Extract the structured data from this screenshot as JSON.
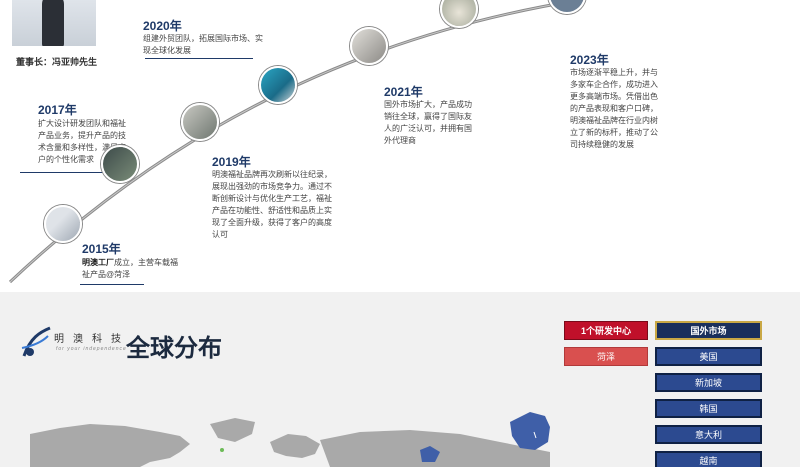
{
  "timeline": {
    "chairman_caption": "董事长：冯亚帅先生",
    "events": [
      {
        "year": "2020年",
        "desc": [
          "组建外贸团队，拓展国际市场、实",
          "现全球化发展"
        ]
      },
      {
        "year": "2017年",
        "desc": [
          "扩大设计研发团队和福祉",
          "产品业务，提升产品的技",
          "术含量和多样性，满足客",
          "户的个性化需求"
        ]
      },
      {
        "year": "2021年",
        "desc": [
          "国外市场扩大，产品成功",
          "销往全球，赢得了国际友",
          "人的广泛认可，并拥有国",
          "外代理商"
        ]
      },
      {
        "year": "2023年",
        "desc": [
          "市场逐渐平稳上升，并与",
          "多家车企合作，成功进入",
          "更多高端市场。凭借出色",
          "的产品表现和客户口碑，",
          "明澳福祉品牌在行业内树",
          "立了新的标杆，推动了公",
          "司持续稳健的发展"
        ]
      },
      {
        "year": "2019年",
        "desc": [
          "明澳福祉品牌再次刷新以往纪录，",
          "展现出强劲的市场竞争力。通过不",
          "断创新设计与优化生产工艺，福祉",
          "产品在功能性、舒适性和品质上实",
          "现了全面升级，获得了客户的高度",
          "认可"
        ]
      },
      {
        "year": "2015年",
        "desc_bold": "明澳工厂",
        "desc_rest": "成立，主营车载福",
        "desc_line2": "祉产品@菏泽"
      }
    ]
  },
  "global": {
    "brand_cn": "明澳科技",
    "brand_en": "for your independence",
    "title": "全球分布",
    "rd_header": "1个研发中心",
    "rd_items": [
      "菏泽"
    ],
    "market_header": "国外市场",
    "market_items": [
      "美国",
      "新加坡",
      "韩国",
      "意大利",
      "越南"
    ]
  },
  "colors": {
    "navy": "#1f3a68",
    "red": "#c0102a",
    "market_blue": "#2c4a90"
  }
}
